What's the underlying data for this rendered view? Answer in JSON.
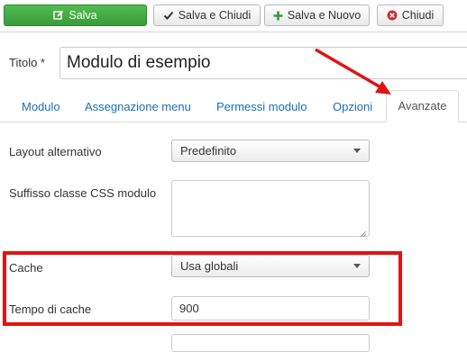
{
  "toolbar": {
    "save_label": "Salva",
    "save_close_label": "Salva e Chiudi",
    "save_new_label": "Salva e Nuovo",
    "close_label": "Chiudi"
  },
  "title_field": {
    "label": "Titolo *",
    "value": "Modulo di esempio"
  },
  "tabs": [
    {
      "label": "Modulo",
      "active": false
    },
    {
      "label": "Assegnazione menu",
      "active": false
    },
    {
      "label": "Permessi modulo",
      "active": false
    },
    {
      "label": "Opzioni",
      "active": false
    },
    {
      "label": "Avanzate",
      "active": true
    }
  ],
  "form": {
    "layout": {
      "label": "Layout alternativo",
      "value": "Predefinito"
    },
    "css_suffix": {
      "label": "Suffisso classe CSS modulo",
      "value": ""
    },
    "cache": {
      "label": "Cache",
      "value": "Usa globali"
    },
    "cache_time": {
      "label": "Tempo di cache",
      "value": "900"
    }
  },
  "colors": {
    "save_button": "#3a9a3a",
    "link": "#1a6fb5",
    "annotation": "#e01414"
  },
  "icons": {
    "save": "edit-icon",
    "save_close": "check-icon",
    "save_new": "plus-icon",
    "close": "close-circle-icon"
  }
}
